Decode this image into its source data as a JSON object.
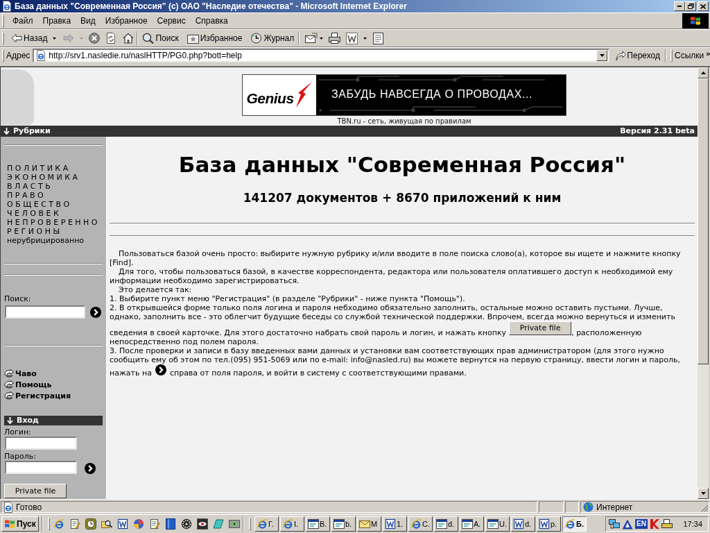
{
  "window": {
    "title": "База данных \"Современная Россия\" (c) ОАО \"Наследие отечества\" - Microsoft Internet Explorer"
  },
  "menu": [
    "Файл",
    "Правка",
    "Вид",
    "Избранное",
    "Сервис",
    "Справка"
  ],
  "toolbar": {
    "back": {
      "label": "Назад"
    },
    "forward": {
      "disabled": true
    },
    "search": {
      "label": "Поиск"
    },
    "favorites": {
      "label": "Избранное"
    },
    "history": {
      "label": "Журнал"
    }
  },
  "address_bar": {
    "label": "Адрес",
    "url": "http://srv1.nasledie.ru/naslHTTP/PG0.php?bott=help",
    "go": "Переход",
    "links": "Ссылки",
    "more": "»"
  },
  "page": {
    "banner": {
      "brand": "Genius",
      "slogan": "ЗАБУДЬ НАВСЕГДА О ПРОВОДАХ...",
      "caption": "TBN.ru - сеть, живущая по правилам"
    },
    "section_bar": {
      "title": "Рубрики",
      "version": "Версия 2.31 beta"
    },
    "sidebar": {
      "categories": [
        "П О Л И Т И К А",
        "Э К О Н О М И К А",
        "В Л А С Т Ь",
        "П Р А В О",
        "О Б Щ Е С Т В О",
        "Ч Е Л О В Е К",
        "Н Е П Р О В Е Р Е Н Н О",
        "Р Е Г И О Н Ы",
        "нерубрицированно"
      ],
      "search_label": "Поиск:",
      "links": [
        "Чаво",
        "Помощь",
        "Регистрация"
      ],
      "login": {
        "title": "Вход",
        "login_label": "Логин:",
        "password_label": "Пароль:",
        "button": "Private file"
      }
    },
    "main": {
      "title": "База данных \"Современная Россия\"",
      "subtitle": "141207 документов + 8670 приложений к ним",
      "help": [
        {
          "kind": "text",
          "indent": true,
          "text": "Пользоваться базой очень просто: выбирите нужную рубрику и/или вводите в поле поиска слово(а), которое вы ищете и нажмите кнопку [Find]."
        },
        {
          "kind": "text",
          "indent": true,
          "text": "Для того, чтобы пользоваться базой, в качестве корреспондента, редактора или пользователя оплатившего доступ к необходимой ему информации необходимо зарегистрироваться."
        },
        {
          "kind": "text",
          "indent": true,
          "text": "Это делается так:"
        },
        {
          "kind": "text",
          "indent": false,
          "text": "1. Выбирите пункт меню \"Регистрация\" (в разделе \"Рубрики\" - ниже пункта \"Помощь\")."
        },
        {
          "kind": "button",
          "indent": false,
          "text": "2. В открывшейся форме только поля логина и пароля небходимо обязательно заполнить, остальные можно оставить пустыми. Лучше, однако, заполнить все - это облегчит будущие беседы со службой технической поддержки. Впрочем, всегда можно вернуться и изменить",
          "line": "сведения в своей карточке. Для этого достаточно набрать свой пароль и логин, и нажать кнопку",
          "button": "Private file",
          "line_end": ", расположенную",
          "text_after": "непосредственно под полем пароля."
        },
        {
          "kind": "icon",
          "indent": false,
          "text": "3. После проверки и записи в базу введенных вами данных и установки вам соответствующих прав администратором (для этого нужно сообщить ему об этом по тел.(095) 951-5069 или по e-mail: info@nasled.ru) вы можете вернутся на первую страницу, ввести логин и пароль,",
          "line": "нажать на",
          "line_end": "справа от поля пароля, и войти в систему с соответствующими правами."
        }
      ]
    }
  },
  "status_bar": {
    "text": "Готово",
    "zone": "Интернет"
  },
  "taskbar": {
    "start": "Пуск",
    "tasks": [
      {
        "kind": "browser",
        "label": "Г.",
        "selected": false
      },
      {
        "kind": "browser",
        "label": "I.",
        "selected": false
      },
      {
        "kind": "app",
        "label": "В.",
        "selected": false
      },
      {
        "kind": "app",
        "label": "b.",
        "selected": false
      },
      {
        "kind": "mail",
        "label": "M",
        "selected": false
      },
      {
        "kind": "document",
        "label": "1.",
        "selected": false
      },
      {
        "kind": "browser",
        "label": "C.",
        "selected": false
      },
      {
        "kind": "app",
        "label": "d.",
        "selected": false
      },
      {
        "kind": "app",
        "label": "A.",
        "selected": false
      },
      {
        "kind": "app",
        "label": "U.",
        "selected": false
      },
      {
        "kind": "document",
        "label": "d.",
        "selected": false
      },
      {
        "kind": "document",
        "label": "p.",
        "selected": false
      },
      {
        "kind": "browser",
        "label": "Б.",
        "selected": true
      }
    ],
    "tray": {
      "language": "EN",
      "time": "17:34"
    }
  }
}
